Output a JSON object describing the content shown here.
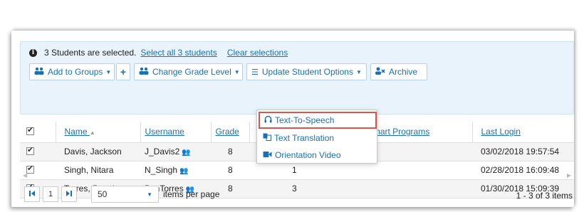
{
  "selection": {
    "message": "3 Students are selected.",
    "select_all_label": "Select all 3 students",
    "clear_label": "Clear selections"
  },
  "toolbar": {
    "add_to_groups_label": "Add to Groups",
    "add_label": "+",
    "change_grade_label": "Change Grade Level",
    "update_options_label": "Update Student Options",
    "archive_label": "Archive"
  },
  "dropdown": {
    "items": [
      {
        "label": "Text-To-Speech",
        "icon": "headphones-icon",
        "highlighted": true
      },
      {
        "label": "Text Translation",
        "icon": "translate-icon",
        "highlighted": false
      },
      {
        "label": "Orientation Video",
        "icon": "video-icon",
        "highlighted": false
      }
    ]
  },
  "table": {
    "columns": [
      "Name",
      "Username",
      "Grade",
      "UpSmart Programs",
      "Last Login"
    ],
    "sort_indicator": "▲",
    "rows": [
      {
        "checked": true,
        "name": "Davis, Jackson",
        "username": "J_Davis2",
        "grade": "8",
        "programs": "",
        "last_login": "03/02/2018 19:57:54"
      },
      {
        "checked": true,
        "name": "Singh, Nitara",
        "username": "N_Singh",
        "grade": "8",
        "programs": "1",
        "last_login": "02/28/2018 16:09:48"
      },
      {
        "checked": true,
        "name": "Torres, Penelope",
        "username": "PenTorres",
        "grade": "8",
        "programs": "3",
        "last_login": "01/30/2018 15:09:39"
      }
    ]
  },
  "pager": {
    "first_icon": "first-page-icon",
    "page": "1",
    "last_icon": "last-page-icon",
    "per_page_value": "50",
    "per_page_label": "items per page",
    "count_text": "1 - 3 of 3 items"
  },
  "colors": {
    "accent": "#1a6fb5",
    "info_bg": "#e8f3fb",
    "highlight_border": "#d9534f"
  }
}
